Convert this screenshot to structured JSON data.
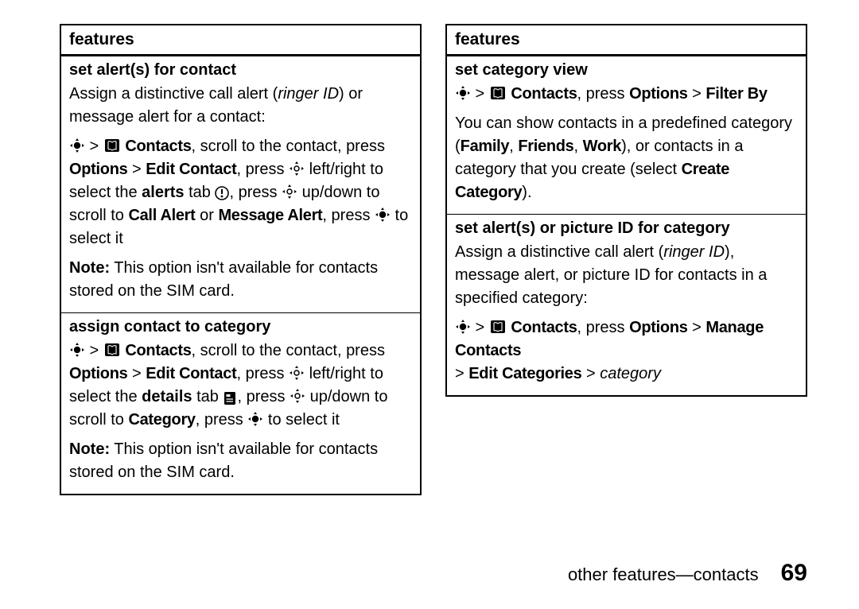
{
  "left": {
    "header": "features",
    "sections": [
      {
        "title": "set alert(s) for contact",
        "intro": "Assign a distinctive call alert (",
        "intro_italic": "ringer ID",
        "intro_after": ") or message alert for a contact:",
        "nav_contacts": "Contacts",
        "nav_scroll": ", scroll to the contact, press ",
        "options": "Options",
        "gt_edit": "> ",
        "edit_contact": "Edit Contact",
        "press": ", press ",
        "lr": " left/right to select the ",
        "alerts_bold": "alerts",
        "tab": " tab ",
        "press2": ", press ",
        "ud": " up/down to scroll to ",
        "call_alert": "Call Alert",
        "or": " or ",
        "msg_alert": "Message Alert",
        "press3": ", press ",
        "select": " to select it",
        "note_label": "Note:",
        "note_text": " This option isn't available for contacts stored on the SIM card."
      },
      {
        "title": "assign contact to category",
        "nav_contacts": "Contacts",
        "nav_scroll": ", scroll to the contact, press ",
        "options": "Options",
        "gt_edit": "> ",
        "edit_contact": "Edit Contact",
        "press": ", press ",
        "lr": " left/right to select the ",
        "details_bold": "details",
        "tab": " tab ",
        "press2": ", press ",
        "ud": " up/down to scroll to ",
        "category": "Category",
        "press3": ", press ",
        "select": " to select it",
        "note_label": "Note:",
        "note_text": " This option isn't available for contacts stored on the SIM card."
      }
    ]
  },
  "right": {
    "header": "features",
    "sections": [
      {
        "title": "set category view",
        "nav_contacts": "Contacts",
        "press": ", press ",
        "options": "Options",
        "gt": " > ",
        "filter_by": "Filter By",
        "body_pre": "You can show contacts in a predefined category (",
        "family": "Family",
        "sep1": ", ",
        "friends": "Friends",
        "sep2": ", ",
        "work": "Work",
        "body_mid": "), or contacts in a category that you create (select ",
        "create_cat": "Create Category",
        "body_end": ")."
      },
      {
        "title": "set alert(s) or picture ID for category",
        "intro_pre": "Assign a distinctive call alert (",
        "intro_italic": "ringer ID",
        "intro_post": "), message alert, or picture ID for contacts in a specified category:",
        "nav_contacts": "Contacts",
        "press": ", press ",
        "options": "Options",
        "gt": " > ",
        "manage": "Manage Contacts",
        "gt2": "> ",
        "edit_cats": "Edit Categories",
        "gt3": " > ",
        "category_italic": "category"
      }
    ]
  },
  "footer": {
    "label": "other features—contacts",
    "page": "69"
  },
  "icons": {
    "center": "center-key",
    "book": "contacts-icon",
    "nav": "nav-key",
    "alerts_tab": "alerts-tab-icon",
    "details_tab": "details-tab-icon"
  }
}
